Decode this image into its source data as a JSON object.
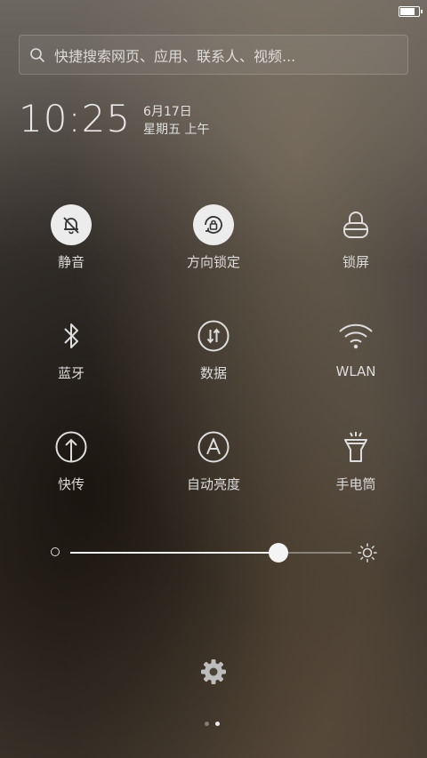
{
  "status_bar": {
    "battery_level": 0.85
  },
  "search": {
    "placeholder": "快捷搜索网页、应用、联系人、视频..."
  },
  "clock": {
    "time": "10:25",
    "date": "6月17日",
    "weekday_period": "星期五 上午"
  },
  "tiles": [
    {
      "label": "静音",
      "icon": "bell-off-icon",
      "active": true
    },
    {
      "label": "方向锁定",
      "icon": "rotation-lock-icon",
      "active": true
    },
    {
      "label": "锁屏",
      "icon": "lock-icon",
      "active": false
    },
    {
      "label": "蓝牙",
      "icon": "bluetooth-icon",
      "active": false
    },
    {
      "label": "数据",
      "icon": "mobile-data-icon",
      "active": false
    },
    {
      "label": "WLAN",
      "icon": "wifi-icon",
      "active": false
    },
    {
      "label": "快传",
      "icon": "quick-transfer-icon",
      "active": false
    },
    {
      "label": "自动亮度",
      "icon": "auto-brightness-icon",
      "active": false
    },
    {
      "label": "手电筒",
      "icon": "flashlight-icon",
      "active": false
    }
  ],
  "brightness": {
    "level": 0.74
  },
  "pager": {
    "pages": 2,
    "current": 2
  },
  "colors": {
    "active_bg": "#ececec",
    "icon": "#dcdcdc"
  }
}
